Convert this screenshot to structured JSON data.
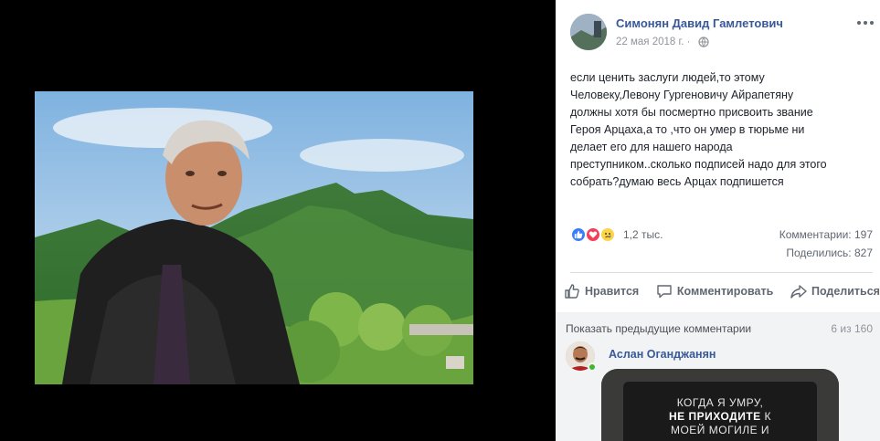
{
  "post": {
    "author": "Симонян Давид Гамлетович",
    "date": "22 мая 2018 г. ·",
    "text": "если ценить заслуги людей,то этому\nЧеловеку,Левону Гургеновичу Айрапетяну\nдолжны хотя бы посмертно присвоить звание\nГероя Арцаха,а то ,что он умер в тюрьме ни\nделает его для нашего народа\nпреступником..сколько подписей надо для этого\nсобрать?думаю весь Арцах подпишется"
  },
  "reactions": {
    "icons": [
      "like-reaction-icon",
      "love-reaction-icon",
      "sad-reaction-icon"
    ],
    "count": "1,2 тыс.",
    "comments": "Комментарии: 197",
    "shares": "Поделились: 827"
  },
  "actions": {
    "like": "Нравится",
    "comment": "Комментировать",
    "share": "Поделиться"
  },
  "comments": {
    "show_previous": "Показать предыдущие комментарии",
    "pager": "6 из 160",
    "first": {
      "author": "Аслан Оганджанян",
      "image_text": {
        "line1": "КОГДА Я УМРУ,",
        "line2_bold": "НЕ ПРИХОДИТЕ",
        "line2_rest": " К",
        "line3": "МОЕЙ МОГИЛЕ И"
      }
    }
  },
  "colors": {
    "link": "#385898",
    "secondary_text": "#606770",
    "like_blue": "#3b7ef7",
    "love_red": "#f33e58",
    "sad_yellow": "#fcd44a",
    "online_green": "#42b72a"
  }
}
